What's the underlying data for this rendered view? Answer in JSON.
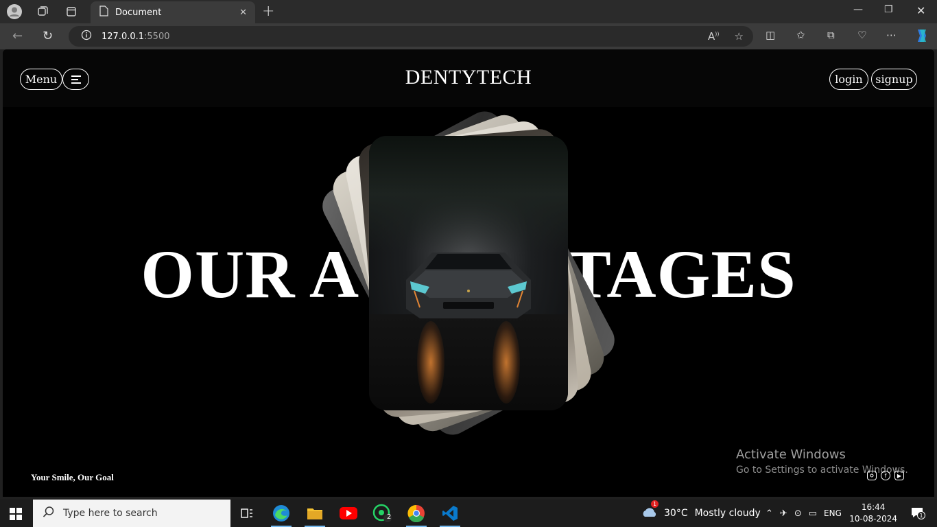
{
  "browser": {
    "tab_title": "Document",
    "url_host": "127.0.0.1",
    "url_port": ":5500"
  },
  "site": {
    "brand": "DENTYTECH",
    "menu_label": "Menu",
    "login_label": "login",
    "signup_label": "signup",
    "hero_left": "OUR A",
    "hero_right": "TAGES",
    "tagline": "Your Smile, Our Goal",
    "socials": [
      "instagram-icon",
      "facebook-icon",
      "youtube-icon"
    ]
  },
  "watermark": {
    "title": "Activate Windows",
    "subtitle": "Go to Settings to activate Windows."
  },
  "taskbar": {
    "search_placeholder": "Type here to search",
    "weather_temp": "30°C",
    "weather_desc": "Mostly cloudy",
    "weather_badge": "1",
    "whatsapp_badge": "2",
    "language": "ENG",
    "time": "16:44",
    "date": "10-08-2024",
    "notification_count": "1"
  },
  "colors": {
    "page_bg": "#000000",
    "navbar_bg": "#060606",
    "text": "#ffffff",
    "headlight_glow": "#e08434",
    "car_accent": "#5cc8d0"
  }
}
